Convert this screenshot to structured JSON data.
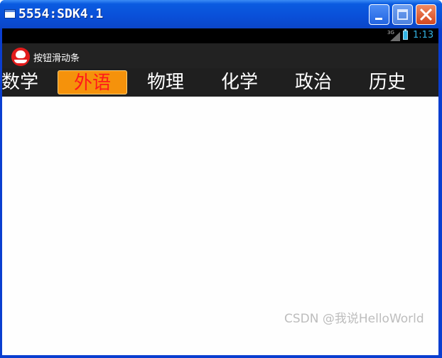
{
  "window": {
    "title": "5554:SDK4.1"
  },
  "statusbar": {
    "network": "3G",
    "time": "1:13"
  },
  "actionbar": {
    "app_title": "按钮滑动条"
  },
  "tabs": [
    {
      "label": "数学",
      "selected": false
    },
    {
      "label": "外语",
      "selected": true
    },
    {
      "label": "物理",
      "selected": false
    },
    {
      "label": "化学",
      "selected": false
    },
    {
      "label": "政治",
      "selected": false
    },
    {
      "label": "历史",
      "selected": false
    }
  ],
  "watermark": "CSDN @我说HelloWorld",
  "colors": {
    "selected_tab_bg": "#f5920b",
    "selected_tab_text": "#ff1a1a",
    "clock": "#33b5e5"
  }
}
